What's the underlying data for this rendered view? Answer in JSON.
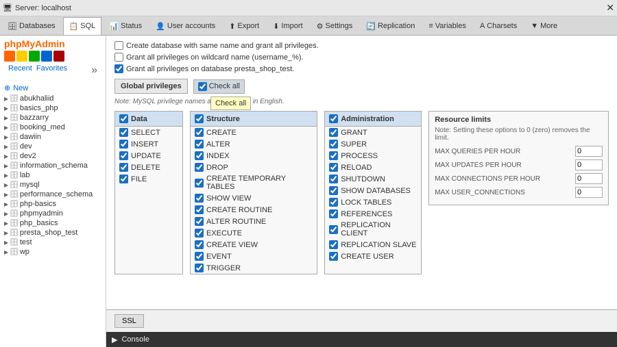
{
  "topbar": {
    "title": "Server: localhost"
  },
  "maintabs": [
    {
      "id": "databases",
      "label": "Databases",
      "icon": "🗄",
      "active": false
    },
    {
      "id": "sql",
      "label": "SQL",
      "icon": "📋",
      "active": true
    },
    {
      "id": "status",
      "label": "Status",
      "icon": "📊",
      "active": false
    },
    {
      "id": "user-accounts",
      "label": "User accounts",
      "icon": "👤",
      "active": false
    },
    {
      "id": "export",
      "label": "Export",
      "icon": "⬆",
      "active": false
    },
    {
      "id": "import",
      "label": "Import",
      "icon": "⬇",
      "active": false
    },
    {
      "id": "settings",
      "label": "Settings",
      "icon": "⚙",
      "active": false
    },
    {
      "id": "replication",
      "label": "Replication",
      "icon": "🔄",
      "active": false
    },
    {
      "id": "variables",
      "label": "Variables",
      "icon": "≡",
      "active": false
    },
    {
      "id": "charsets",
      "label": "Charsets",
      "icon": "A",
      "active": false
    },
    {
      "id": "more",
      "label": "More",
      "icon": "▼",
      "active": false
    }
  ],
  "sidebar": {
    "logo": "phpMyAdmin",
    "recent_label": "Recent",
    "favorites_label": "Favorites",
    "new_label": "New",
    "databases": [
      {
        "name": "abukhaliid",
        "active": false
      },
      {
        "name": "basics_php",
        "active": false
      },
      {
        "name": "bazzarry",
        "active": false
      },
      {
        "name": "booking_med",
        "active": false
      },
      {
        "name": "dawiin",
        "active": false
      },
      {
        "name": "dev",
        "active": false
      },
      {
        "name": "dev2",
        "active": false
      },
      {
        "name": "information_schema",
        "active": false
      },
      {
        "name": "lab",
        "active": false
      },
      {
        "name": "mysql",
        "active": false
      },
      {
        "name": "performance_schema",
        "active": false
      },
      {
        "name": "php-basics",
        "active": false
      },
      {
        "name": "phpmyadmin",
        "active": false
      },
      {
        "name": "php_basics",
        "active": false
      },
      {
        "name": "presta_shop_test",
        "active": false
      },
      {
        "name": "test",
        "active": false
      },
      {
        "name": "wp",
        "active": false
      }
    ]
  },
  "content": {
    "top_checkboxes": [
      {
        "id": "chk1",
        "label": "Create database with same name and grant all privileges.",
        "checked": false
      },
      {
        "id": "chk2",
        "label": "Grant all privileges on wildcard name (username_%).",
        "checked": false
      },
      {
        "id": "chk3",
        "label": "Grant all privileges on database presta_shop_test.",
        "checked": true
      }
    ],
    "global_privileges_label": "Global privileges",
    "check_all_label": "Check all",
    "tooltip_label": "Check all",
    "note": "Note: MySQL privilege names are expressed in English.",
    "panels": [
      {
        "id": "data",
        "title": "Data",
        "checked": true,
        "items": [
          {
            "label": "SELECT",
            "checked": true
          },
          {
            "label": "INSERT",
            "checked": true
          },
          {
            "label": "UPDATE",
            "checked": true
          },
          {
            "label": "DELETE",
            "checked": true
          },
          {
            "label": "FILE",
            "checked": true
          }
        ]
      },
      {
        "id": "structure",
        "title": "Structure",
        "checked": true,
        "items": [
          {
            "label": "CREATE",
            "checked": true
          },
          {
            "label": "ALTER",
            "checked": true
          },
          {
            "label": "INDEX",
            "checked": true
          },
          {
            "label": "DROP",
            "checked": true
          },
          {
            "label": "CREATE TEMPORARY TABLES",
            "checked": true
          },
          {
            "label": "SHOW VIEW",
            "checked": true
          },
          {
            "label": "CREATE ROUTINE",
            "checked": true
          },
          {
            "label": "ALTER ROUTINE",
            "checked": true
          },
          {
            "label": "EXECUTE",
            "checked": true
          },
          {
            "label": "CREATE VIEW",
            "checked": true
          },
          {
            "label": "EVENT",
            "checked": true
          },
          {
            "label": "TRIGGER",
            "checked": true
          }
        ]
      },
      {
        "id": "administration",
        "title": "Administration",
        "checked": true,
        "items": [
          {
            "label": "GRANT",
            "checked": true
          },
          {
            "label": "SUPER",
            "checked": true
          },
          {
            "label": "PROCESS",
            "checked": true
          },
          {
            "label": "RELOAD",
            "checked": true
          },
          {
            "label": "SHUTDOWN",
            "checked": true
          },
          {
            "label": "SHOW DATABASES",
            "checked": true
          },
          {
            "label": "LOCK TABLES",
            "checked": true
          },
          {
            "label": "REFERENCES",
            "checked": true
          },
          {
            "label": "REPLICATION CLIENT",
            "checked": true
          },
          {
            "label": "REPLICATION SLAVE",
            "checked": true
          },
          {
            "label": "CREATE USER",
            "checked": true
          }
        ]
      }
    ],
    "resource_limits": {
      "title": "Resource limits",
      "note": "Note: Setting these options to 0 (zero) removes the limit.",
      "fields": [
        {
          "label": "MAX QUERIES PER HOUR",
          "value": "0"
        },
        {
          "label": "MAX UPDATES PER HOUR",
          "value": "0"
        },
        {
          "label": "MAX CONNECTIONS PER HOUR",
          "value": "0"
        },
        {
          "label": "MAX USER_CONNECTIONS",
          "value": "0"
        }
      ]
    },
    "ssl_label": "SSL",
    "console_label": "Console",
    "create_label": "CREATE"
  }
}
